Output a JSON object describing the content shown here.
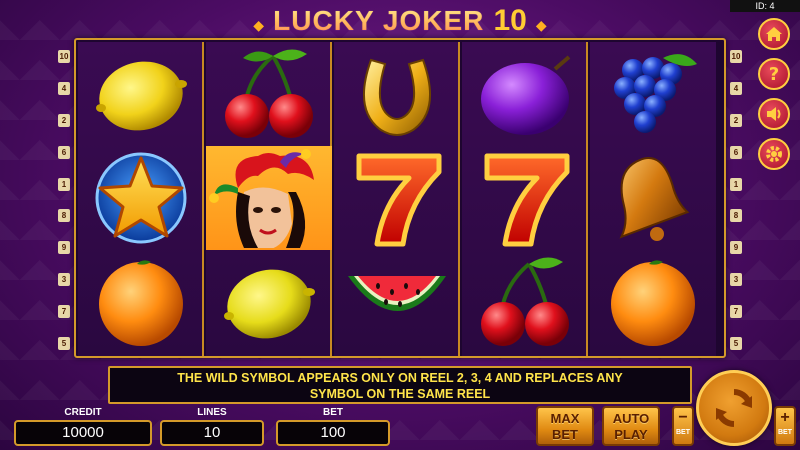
{
  "game": {
    "id_label": "ID: 4",
    "title": "LUCKY JOKER",
    "title_number": "10"
  },
  "reels": [
    [
      "lemon",
      "star",
      "orange"
    ],
    [
      "cherries",
      "joker-wild",
      "lemon"
    ],
    [
      "horseshoe",
      "seven",
      "watermelon"
    ],
    [
      "plum",
      "seven",
      "cherries"
    ],
    [
      "grapes",
      "bell",
      "orange"
    ]
  ],
  "paylines": {
    "left": [
      "10",
      "4",
      "2",
      "6",
      "1",
      "8",
      "9",
      "3",
      "7",
      "5"
    ],
    "right": [
      "10",
      "4",
      "2",
      "6",
      "1",
      "8",
      "9",
      "3",
      "7",
      "5"
    ]
  },
  "side_buttons": [
    {
      "icon": "home-icon"
    },
    {
      "icon": "help-icon",
      "label": "?"
    },
    {
      "icon": "sound-icon"
    },
    {
      "icon": "settings-icon"
    }
  ],
  "info": {
    "message_line1": "THE WILD SYMBOL APPEARS ONLY ON REEL 2, 3, 4 AND REPLACES ANY",
    "message_line2": "SYMBOL ON THE SAME REEL"
  },
  "stats": {
    "credit_label": "CREDIT",
    "credit_value": "10000",
    "lines_label": "LINES",
    "lines_value": "10",
    "bet_label": "BET",
    "bet_value": "100"
  },
  "controls": {
    "max_bet_line1": "MAX",
    "max_bet_line2": "BET",
    "auto_play_line1": "AUTO",
    "auto_play_line2": "PLAY",
    "bet_minus_symbol": "−",
    "bet_plus_symbol": "+",
    "bet_minus_label": "BET",
    "bet_plus_label": "BET",
    "spin_icon": "spin-icon"
  },
  "colors": {
    "frame_gold": "#d49a2a",
    "info_text": "#ffe44a",
    "background": "#4b0c63"
  }
}
